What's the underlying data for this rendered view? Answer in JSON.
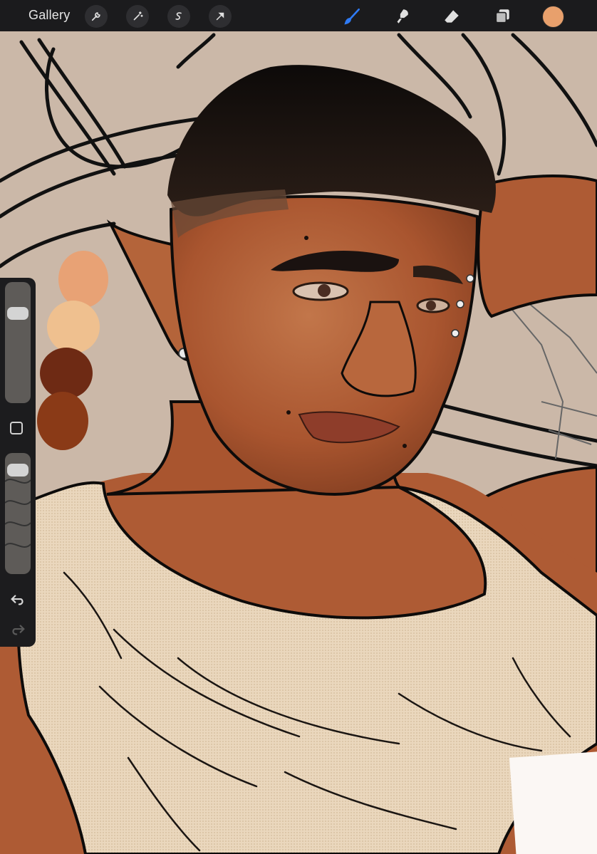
{
  "toolbar": {
    "gallery_label": "Gallery",
    "left_buttons": [
      "wrench-icon",
      "magic-wand-icon",
      "selection-icon",
      "transform-arrow-icon"
    ],
    "right_tools": [
      "brush-icon",
      "smudge-icon",
      "eraser-icon",
      "layers-icon"
    ],
    "active_tool": "brush-icon",
    "current_color": "#e8a06c"
  },
  "palette": {
    "swatches": [
      "#e8a275",
      "#efc08f",
      "#6e2a14",
      "#8a3a17"
    ]
  },
  "sidebar": {
    "brush_size_level": 0.22,
    "opacity_level": 0.92,
    "icons": [
      "square-icon",
      "undo-icon",
      "redo-icon"
    ]
  },
  "canvas": {
    "background": "#cbb8a8",
    "skin": "#ae5b34",
    "shirt": "#ead7bd",
    "hair": "#151210",
    "line": "#0d0b0a"
  }
}
